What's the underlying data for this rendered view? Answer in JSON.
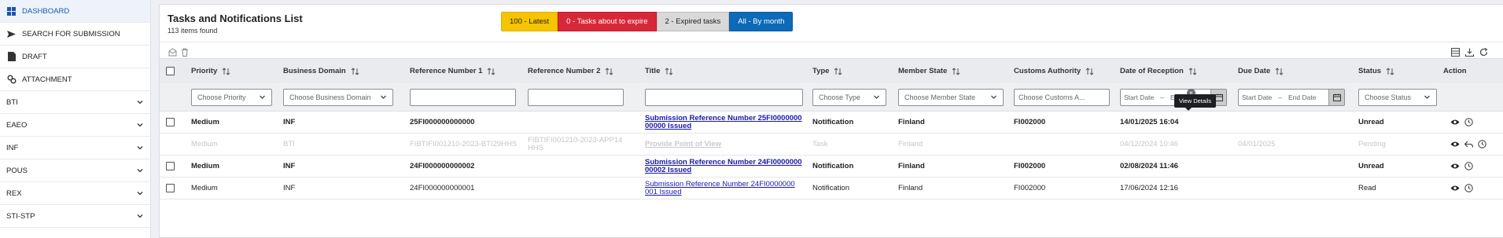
{
  "sidebar": {
    "items": [
      {
        "label": "DASHBOARD",
        "icon": "grid-icon"
      },
      {
        "label": "SEARCH FOR SUBMISSION",
        "icon": "send-icon"
      },
      {
        "label": "DRAFT",
        "icon": "document-icon"
      },
      {
        "label": "ATTACHMENT",
        "icon": "link-icon"
      },
      {
        "label": "BTI"
      },
      {
        "label": "EAEO"
      },
      {
        "label": "INF"
      },
      {
        "label": "POUS"
      },
      {
        "label": "REX"
      },
      {
        "label": "STI-STP"
      }
    ]
  },
  "header": {
    "title": "Tasks and Notifications List",
    "count": "113 items found"
  },
  "filters": {
    "latest": "100 - Latest",
    "expire": "0 - Tasks about to expire",
    "expired": "2 - Expired tasks",
    "all": "All - By month",
    "colors": {
      "latest": "#f6c400",
      "expire": "#d7283a",
      "expired": "#d9d9d9",
      "all": "#0c6ab8"
    }
  },
  "table": {
    "columns": {
      "priority": "Priority",
      "domain": "Business Domain",
      "ref1": "Reference Number 1",
      "ref2": "Reference Number 2",
      "title": "Title",
      "type": "Type",
      "member": "Member State",
      "customs": "Customs Authority",
      "reception": "Date of Reception",
      "due": "Due Date",
      "status": "Status",
      "action": "Action"
    },
    "filter_placeholders": {
      "priority": "Choose Priority",
      "domain": "Choose Business Domain",
      "type": "Choose Type",
      "member": "Choose Member State",
      "customs": "Choose Customs A...",
      "start": "Start Date",
      "end": "End Date",
      "status": "Choose Status"
    },
    "rows": [
      {
        "priority": "Medium",
        "domain": "INF",
        "ref1": "25FI000000000000",
        "ref2": "",
        "title_line1": "Submission Reference Number 25FI0000000",
        "title_line2": "00000 Issued",
        "type": "Notification",
        "member": "Finland",
        "customs": "FI002000",
        "reception": "14/01/2025 16:04",
        "due": "",
        "status": "Unread"
      },
      {
        "priority": "Medium",
        "domain": "BTI",
        "ref1": "FIBTIFI001210-2023-BTI29HHS",
        "ref2_line1": "FIBTIFI001210-2023-APP14",
        "ref2_line2": "HHS",
        "title_line1": "Provide Point of View",
        "title_line2": "",
        "type": "Task",
        "member": "Finland",
        "customs": "",
        "reception": "04/12/2024 10:46",
        "due": "04/01/2025",
        "status": "Pending"
      },
      {
        "priority": "Medium",
        "domain": "INF",
        "ref1": "24FI000000000002",
        "ref2": "",
        "title_line1": "Submission Reference Number 24FI0000000",
        "title_line2": "00002 Issued",
        "type": "Notification",
        "member": "Finland",
        "customs": "FI002000",
        "reception": "02/08/2024 11:46",
        "due": "",
        "status": "Unread"
      },
      {
        "priority": "Medium",
        "domain": "INF",
        "ref1": "24FI000000000001",
        "ref2": "",
        "title_line1": "Submission Reference Number 24FI0000000",
        "title_line2": "001 Issued",
        "type": "Notification",
        "member": "Finland",
        "customs": "FI002000",
        "reception": "17/06/2024 12:16",
        "due": "",
        "status": "Read"
      }
    ]
  },
  "tooltip": "View Details"
}
